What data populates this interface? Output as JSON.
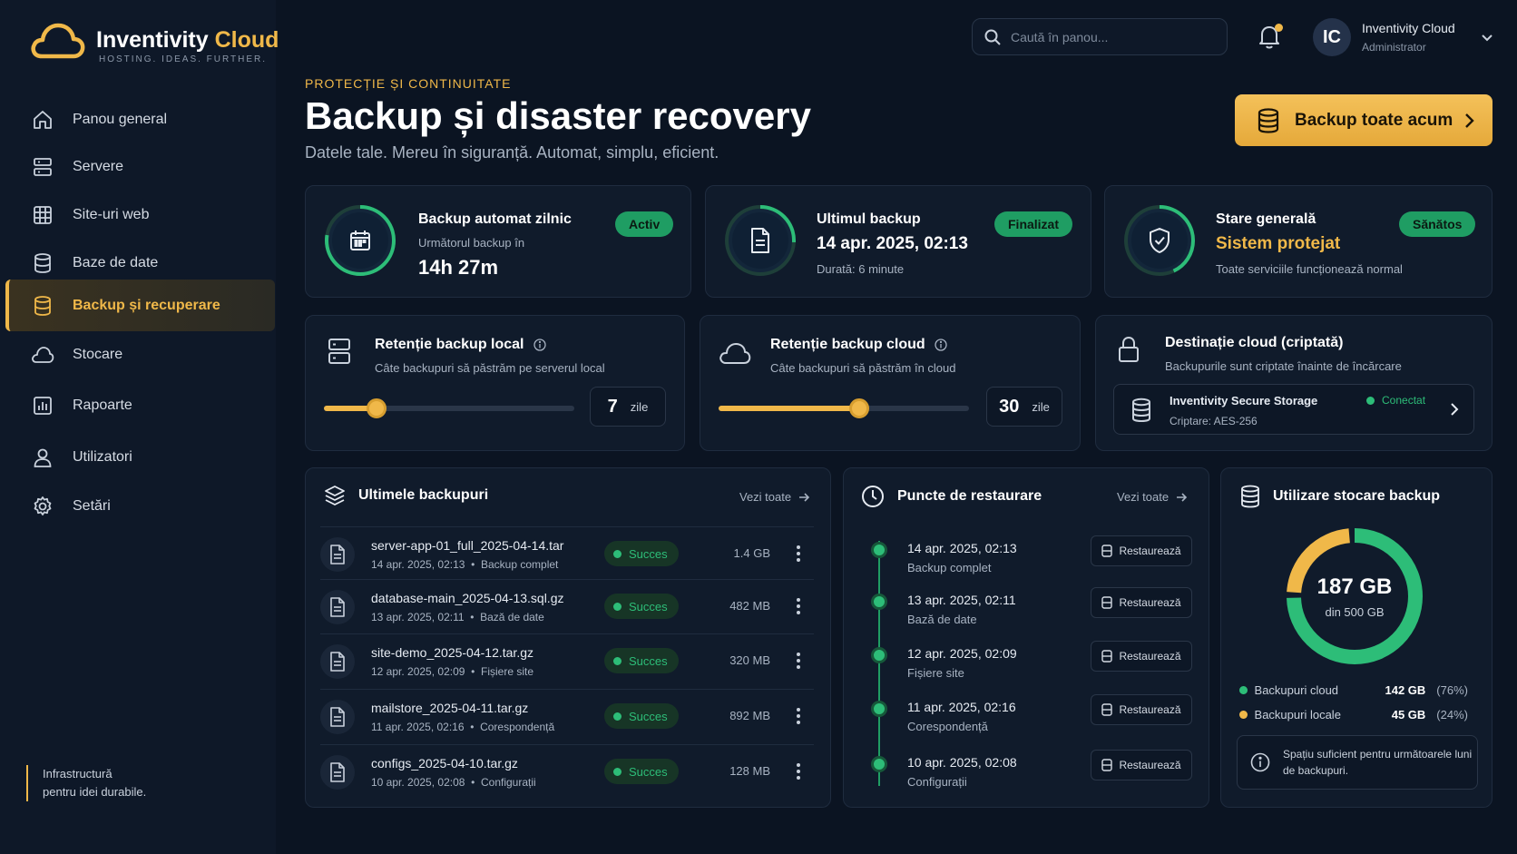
{
  "brand": {
    "name_main": "Inventivity",
    "name_accent": "Cloud",
    "tagline": "HOSTING. IDEAS. FURTHER.",
    "accent_color": "#f0b849",
    "success_color": "#2dbd78"
  },
  "sidebar": {
    "items": [
      {
        "label": "Panou general",
        "icon": "home-icon"
      },
      {
        "label": "Servere",
        "icon": "server-icon"
      },
      {
        "label": "Site-uri web",
        "icon": "globe-icon"
      },
      {
        "label": "Baze de date",
        "icon": "database-icon"
      },
      {
        "label": "Backup și recuperare",
        "icon": "backup-icon",
        "active": true
      },
      {
        "label": "Stocare",
        "icon": "cloud-icon"
      },
      {
        "label": "Rapoarte",
        "icon": "chart-icon"
      },
      {
        "label": "Utilizatori",
        "icon": "user-icon"
      },
      {
        "label": "Setări",
        "icon": "gear-icon"
      }
    ],
    "footer_line1": "Infrastructură",
    "footer_line2": "pentru idei durabile."
  },
  "header": {
    "search_placeholder": "Caută în panou...",
    "user_initials": "IC",
    "user_name": "Inventivity Cloud",
    "user_role": "Administrator"
  },
  "page": {
    "eyebrow": "PROTECȚIE ȘI CONTINUITATE",
    "title": "Backup și disaster recovery",
    "subtitle": "Datele tale. Mereu în siguranță. Automat, simplu, eficient.",
    "primary_button": "Backup toate acum"
  },
  "status_cards": [
    {
      "title": "Backup automat zilnic",
      "sub": "Următorul backup în",
      "big": "14h 27m",
      "badge": "Activ",
      "icon": "calendar-icon"
    },
    {
      "title": "Ultimul backup",
      "big": "14 apr. 2025, 02:13",
      "sub": "Durată: 6 minute",
      "badge": "Finalizat",
      "icon": "file-icon"
    },
    {
      "title": "Stare generală",
      "big": "Sistem protejat",
      "sub": "Toate serviciile funcționează normal",
      "badge": "Sănătos",
      "icon": "shield-icon"
    }
  ],
  "retention": {
    "local": {
      "title": "Retenție backup local",
      "sub": "Câte backupuri să păstrăm pe serverul local",
      "value": "7",
      "unit": "zile",
      "slider_fraction": 0.21
    },
    "cloud": {
      "title": "Retenție backup cloud",
      "sub": "Câte backupuri să păstrăm în cloud",
      "value": "30",
      "unit": "zile",
      "slider_fraction": 0.56
    }
  },
  "destination": {
    "title": "Destinație cloud (criptată)",
    "sub": "Backupurile sunt criptate înainte de încărcare",
    "storage_name": "Inventivity Secure Storage",
    "encryption": "Criptare: AES-256",
    "status": "Conectat"
  },
  "recent_backups": {
    "title": "Ultimele backupuri",
    "see_all": "Vezi toate",
    "rows": [
      {
        "name": "server-app-01_full_2025-04-14.tar",
        "date": "14 apr. 2025, 02:13",
        "type": "Backup complet",
        "status": "Succes",
        "size": "1.4 GB"
      },
      {
        "name": "database-main_2025-04-13.sql.gz",
        "date": "13 apr. 2025, 02:11",
        "type": "Bază de date",
        "status": "Succes",
        "size": "482 MB"
      },
      {
        "name": "site-demo_2025-04-12.tar.gz",
        "date": "12 apr. 2025, 02:09",
        "type": "Fișiere site",
        "status": "Succes",
        "size": "320 MB"
      },
      {
        "name": "mailstore_2025-04-11.tar.gz",
        "date": "11 apr. 2025, 02:16",
        "type": "Corespondență",
        "status": "Succes",
        "size": "892 MB"
      },
      {
        "name": "configs_2025-04-10.tar.gz",
        "date": "10 apr. 2025, 02:08",
        "type": "Configurații",
        "status": "Succes",
        "size": "128 MB"
      }
    ]
  },
  "restore_points": {
    "title": "Puncte de restaurare",
    "see_all": "Vezi toate",
    "button_label": "Restaurează",
    "rows": [
      {
        "date": "14 apr. 2025, 02:13",
        "type": "Backup complet"
      },
      {
        "date": "13 apr. 2025, 02:11",
        "type": "Bază de date"
      },
      {
        "date": "12 apr. 2025, 02:09",
        "type": "Fișiere site"
      },
      {
        "date": "11 apr. 2025, 02:16",
        "type": "Corespondență"
      },
      {
        "date": "10 apr. 2025, 02:08",
        "type": "Configurații"
      }
    ]
  },
  "storage": {
    "title": "Utilizare stocare backup",
    "total_used": "187 GB",
    "of_total": "din 500 GB",
    "legend": [
      {
        "name": "Backupuri cloud",
        "value": "142 GB",
        "pct": "(76%)",
        "fraction": 0.76,
        "color": "#2dbd78"
      },
      {
        "name": "Backupuri locale",
        "value": "45 GB",
        "pct": "(24%)",
        "fraction": 0.24,
        "color": "#f0b849"
      }
    ],
    "note": "Spațiu suficient pentru următoarele luni de backupuri."
  }
}
